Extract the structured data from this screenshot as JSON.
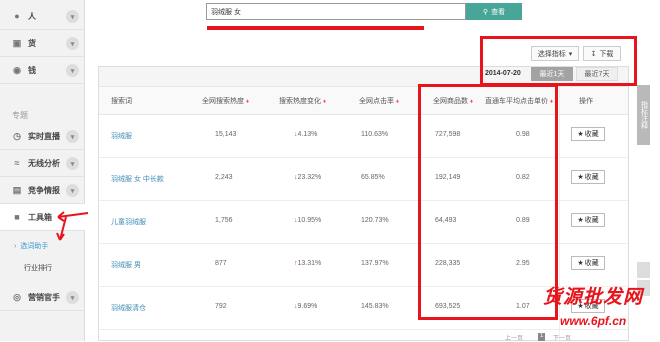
{
  "sidebar": {
    "top_items": [
      {
        "label": "人",
        "icon": "user-icon"
      },
      {
        "label": "货",
        "icon": "goods-icon"
      },
      {
        "label": "钱",
        "icon": "money-icon"
      }
    ],
    "section_title": "专题",
    "items": [
      {
        "label": "实时直播",
        "icon": "clock-icon"
      },
      {
        "label": "无线分析",
        "icon": "wifi-icon"
      },
      {
        "label": "竞争情报",
        "icon": "doc-icon"
      },
      {
        "label": "工具箱",
        "icon": "toolbox-icon"
      }
    ],
    "sub_items": [
      {
        "label": "选词助手",
        "active": true
      },
      {
        "label": "行业排行",
        "active": false
      }
    ],
    "bottom_item": {
      "label": "营销官手",
      "icon": "target-icon"
    }
  },
  "search": {
    "value": "羽绒服 女",
    "button_label": "查看"
  },
  "controls": {
    "indicator_label": "选择指标",
    "download_label": "下载",
    "date": "2014-07-20",
    "range_tabs": [
      "最近1天",
      "最近7天"
    ]
  },
  "table": {
    "headers": [
      "搜索词",
      "全网搜索热度",
      "搜索热度变化",
      "全网点击率",
      "全网商品数",
      "直通车平均点击单价",
      "操作"
    ],
    "rows": [
      {
        "keyword": "羽绒服",
        "heat": "15,143",
        "change": "4.13%",
        "dir": "down",
        "ctr": "110.63%",
        "goods": "727,598",
        "cpc": "0.98"
      },
      {
        "keyword": "羽绒服 女 中长款",
        "heat": "2,243",
        "change": "23.32%",
        "dir": "down",
        "ctr": "65.85%",
        "goods": "192,149",
        "cpc": "0.82"
      },
      {
        "keyword": "儿童羽绒服",
        "heat": "1,756",
        "change": "10.95%",
        "dir": "down",
        "ctr": "120.73%",
        "goods": "64,493",
        "cpc": "0.89"
      },
      {
        "keyword": "羽绒服 男",
        "heat": "877",
        "change": "13.31%",
        "dir": "up",
        "ctr": "137.97%",
        "goods": "228,335",
        "cpc": "2.95"
      },
      {
        "keyword": "羽绒服清仓",
        "heat": "792",
        "change": "9.69%",
        "dir": "down",
        "ctr": "145.83%",
        "goods": "693,525",
        "cpc": "1.07"
      }
    ],
    "fav_label": "收藏"
  },
  "pager": {
    "prev": "上一页",
    "page": "1",
    "next": "下一页"
  },
  "rail": {
    "text": "指标注释"
  },
  "watermark": {
    "line1": "货源批发网",
    "line2": "www.6pf.cn"
  },
  "colors": {
    "accent": "#48a698",
    "annotation": "#e8141b",
    "link": "#3a8bb7"
  }
}
